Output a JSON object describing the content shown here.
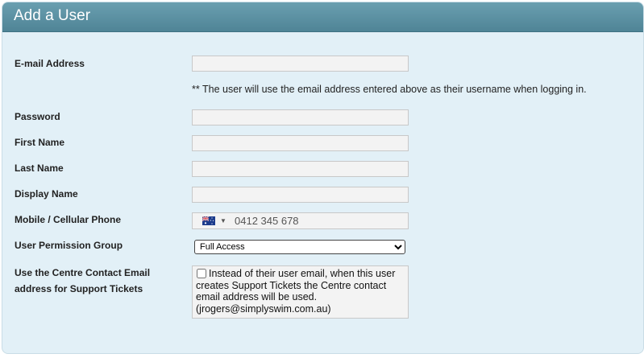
{
  "header": {
    "title": "Add a User"
  },
  "form": {
    "email": {
      "label": "E-mail Address",
      "value": ""
    },
    "email_note": "** The user will use the email address entered above as their username when logging in.",
    "password": {
      "label": "Password",
      "value": ""
    },
    "first_name": {
      "label": "First Name",
      "value": ""
    },
    "last_name": {
      "label": "Last Name",
      "value": ""
    },
    "display_name": {
      "label": "Display Name",
      "value": ""
    },
    "mobile": {
      "label": "Mobile / Cellular Phone",
      "placeholder": "0412 345 678",
      "value": "",
      "country_flag": "australia-flag-icon"
    },
    "permission_group": {
      "label": "User Permission Group",
      "selected": "Full Access"
    },
    "support_tickets": {
      "label": "Use the Centre Contact Email address for Support Tickets",
      "checked": false,
      "text": "Instead of their user email, when this user creates Support Tickets the Centre contact email address will be used. (jrogers@simplyswim.com.au)"
    }
  },
  "colors": {
    "header": "#5a8fa1",
    "panel_bg": "#e2f0f7"
  }
}
